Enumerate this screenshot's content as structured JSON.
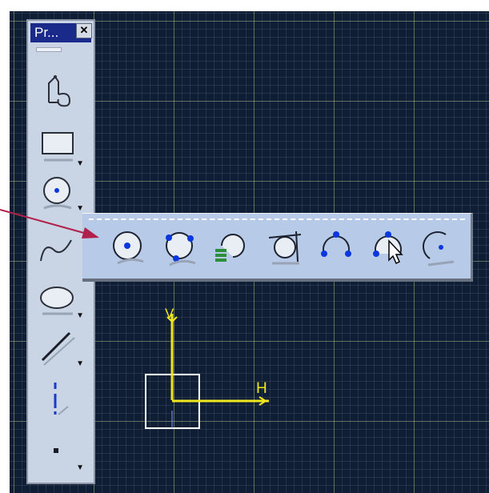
{
  "toolbar": {
    "title": "Pr...",
    "close_symbol": "✕",
    "tools": [
      {
        "name": "profile-tool",
        "icon": "profile-icon"
      },
      {
        "name": "rectangle-tool",
        "icon": "rectangle-icon"
      },
      {
        "name": "circle-tool",
        "icon": "circle-icon"
      },
      {
        "name": "spline-tool",
        "icon": "spline-icon"
      },
      {
        "name": "ellipse-tool",
        "icon": "ellipse-icon"
      },
      {
        "name": "line-tool",
        "icon": "line-icon"
      },
      {
        "name": "axis-tool",
        "icon": "axis-icon"
      },
      {
        "name": "point-tool",
        "icon": "point-icon"
      }
    ]
  },
  "circle_flyout": {
    "tools": [
      {
        "name": "circle",
        "icon": "circle-center-icon"
      },
      {
        "name": "three-point-circle",
        "icon": "three-point-circle-icon"
      },
      {
        "name": "circle-using-coordinates",
        "icon": "circle-coordinates-icon"
      },
      {
        "name": "tri-tangent-circle",
        "icon": "tri-tangent-circle-icon"
      },
      {
        "name": "three-point-arc",
        "icon": "three-point-arc-icon"
      },
      {
        "name": "three-point-arc-with-limits",
        "icon": "three-point-arc-limits-icon"
      },
      {
        "name": "arc",
        "icon": "arc-icon"
      }
    ]
  },
  "sketch_axes": {
    "vertical_label": "V",
    "horizontal_label": "H"
  },
  "colors": {
    "canvas_bg": "#0f1d35",
    "axis": "#f0e81f",
    "titlebar": "#1a2a8a",
    "toolbar_bg": "#c9d4e4",
    "flyout_bg": "#b7cbe8",
    "pointer_arrow": "#b0204a"
  }
}
